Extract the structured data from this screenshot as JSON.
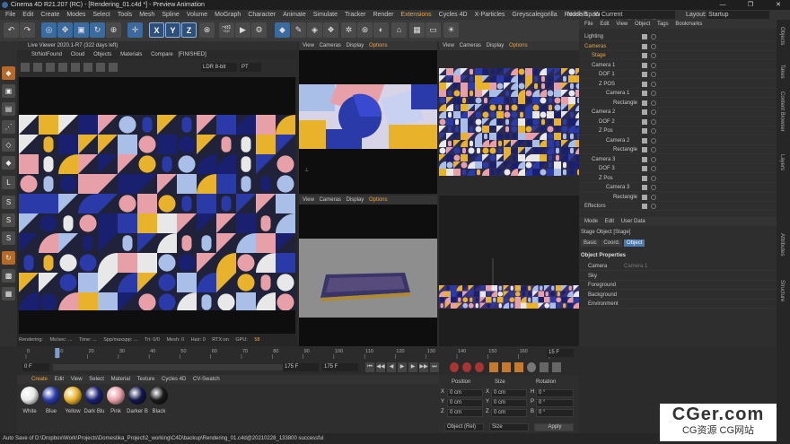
{
  "window": {
    "title": "Cinema 4D R21.207 (RC) - [Rendering_01.c4d *] - Preview Animation",
    "controls": [
      "—",
      "❐",
      "✕"
    ]
  },
  "menu": {
    "items": [
      "File",
      "Edit",
      "Create",
      "Modes",
      "Select",
      "Tools",
      "Mesh",
      "Spline",
      "Volume",
      "MoGraph",
      "Character",
      "Animate",
      "Simulate",
      "Tracker",
      "Render",
      "Extensions",
      "Cycles 4D",
      "X-Particles",
      "Greyscalegorilla",
      "Redshift",
      "Window",
      "Help",
      "Octane"
    ],
    "highlighted": "Extensions",
    "node_space_label": "Node Space:",
    "node_space_value": "Current (Standard/Physical)",
    "layout_label": "Layout:",
    "layout_value": "Startup"
  },
  "toolbar": {
    "xyz": [
      "X",
      "Y",
      "Z"
    ]
  },
  "picture_viewer": {
    "title": "Live Viewer 2020.1-R7 (322 days left)",
    "tabs": [
      "StrNotFound",
      "Cloud",
      "Objects",
      "Materials",
      "Compare",
      "[FINISHED]"
    ],
    "ldr": "LDR 8-bit",
    "pt": "PT",
    "status": {
      "rendering": "Rendering:",
      "mss": "Ms/sec: ...",
      "time": "Time: ...",
      "spp": "Spp/maxspp: ...",
      "tri": "Tri: 0/0",
      "mesh": "Mesh: 0",
      "hair": "Hair: 0",
      "rtx": "RTX:on",
      "gpu": "GPU:",
      "gpu_val": "58"
    }
  },
  "viewport": {
    "menu": [
      "View",
      "Cameras",
      "Display",
      "Options",
      "Filter",
      "Panel"
    ],
    "options_label": "Options"
  },
  "object_manager": {
    "menu": [
      "File",
      "Edit",
      "View",
      "Object",
      "Tags",
      "Bookmarks"
    ],
    "rows": [
      {
        "name": "Lighting",
        "indent": 0
      },
      {
        "name": "Cameras",
        "indent": 0,
        "color": "#e9a54a"
      },
      {
        "name": "Stage",
        "indent": 1,
        "color": "#e9a54a"
      },
      {
        "name": "Camera 1",
        "indent": 1
      },
      {
        "name": "DOF 1",
        "indent": 2
      },
      {
        "name": "Z POS",
        "indent": 2
      },
      {
        "name": "Camera 1",
        "indent": 3
      },
      {
        "name": "Rectangle",
        "indent": 4
      },
      {
        "name": "Camera 2",
        "indent": 1
      },
      {
        "name": "DOF 2",
        "indent": 2
      },
      {
        "name": "Z Pos",
        "indent": 2
      },
      {
        "name": "Camera 2",
        "indent": 3
      },
      {
        "name": "Rectangle",
        "indent": 4
      },
      {
        "name": "Camera 3",
        "indent": 1
      },
      {
        "name": "DOF 3",
        "indent": 2
      },
      {
        "name": "Z Pos",
        "indent": 2
      },
      {
        "name": "Camera 3",
        "indent": 3
      },
      {
        "name": "Rectangle",
        "indent": 4
      },
      {
        "name": "Effectors",
        "indent": 0
      }
    ]
  },
  "attributes": {
    "menu": [
      "Mode",
      "Edit",
      "User Data"
    ],
    "object_title": "Stage Object [Stage]",
    "tabs": [
      "Basic",
      "Coord.",
      "Object"
    ],
    "active_tab": "Object",
    "section": "Object Properties",
    "props": [
      {
        "label": "Camera",
        "value": "Camera 1"
      },
      {
        "label": "Sky",
        "value": ""
      },
      {
        "label": "Foreground",
        "value": ""
      },
      {
        "label": "Background",
        "value": ""
      },
      {
        "label": "Environment",
        "value": ""
      }
    ]
  },
  "right_tabs": [
    "Objects",
    "Takes",
    "Content Browser",
    "Layers",
    "Attributes",
    "Structure"
  ],
  "timeline": {
    "ticks": [
      "0",
      "10",
      "20",
      "30",
      "40",
      "50",
      "60",
      "70",
      "80",
      "90",
      "100",
      "110",
      "120",
      "130",
      "140",
      "150",
      "160",
      "170"
    ],
    "current_frame": "15 F",
    "start_frame": "0 F",
    "start_field": "0 F",
    "end_field": "175 F",
    "end_field2": "175 F",
    "playhead_frame": 10,
    "max_frame": 175
  },
  "material_manager": {
    "menu": [
      "Create",
      "Edit",
      "View",
      "Select",
      "Material",
      "Texture",
      "Cycles 4D",
      "CV-Swatch"
    ],
    "materials": [
      {
        "name": "White",
        "color": "#e8e8e8"
      },
      {
        "name": "Blue",
        "color": "#2a3aa8"
      },
      {
        "name": "Yellow",
        "color": "#e8b22a"
      },
      {
        "name": "Dark Blu",
        "color": "#1a2070"
      },
      {
        "name": "Pink",
        "color": "#e8a0a8"
      },
      {
        "name": "Darker B",
        "color": "#14184a"
      },
      {
        "name": "Black",
        "color": "#1a1a1a"
      }
    ]
  },
  "coordinates": {
    "headers": [
      "Position",
      "Size",
      "Rotation"
    ],
    "rows": [
      {
        "axis": "X",
        "pos": "0 cm",
        "sax": "X",
        "size": "0 cm",
        "rax": "H",
        "rot": "0 °"
      },
      {
        "axis": "Y",
        "pos": "0 cm",
        "sax": "Y",
        "size": "0 cm",
        "rax": "P",
        "rot": "0 °"
      },
      {
        "axis": "Z",
        "pos": "0 cm",
        "sax": "Z",
        "size": "0 cm",
        "rax": "B",
        "rot": "0 °"
      }
    ],
    "mode": "Object (Rel)",
    "size_mode": "Size",
    "apply": "Apply"
  },
  "status_bar": "Auto Save of D:\\Dropbox\\Work\\Projects\\Domestika_Project\\2_working\\C4D\\backup\\Rendering_01.c4d@20210228_133800 successful",
  "watermark": {
    "big": "CGer.com",
    "small": "CG资源 CG网站"
  },
  "colors": {
    "accent": "#e9a54a",
    "pattern_blue": "#2a3aa8",
    "pattern_yellow": "#e8b22a",
    "pattern_pink": "#e8a0a8",
    "pattern_dark": "#1f2238"
  }
}
